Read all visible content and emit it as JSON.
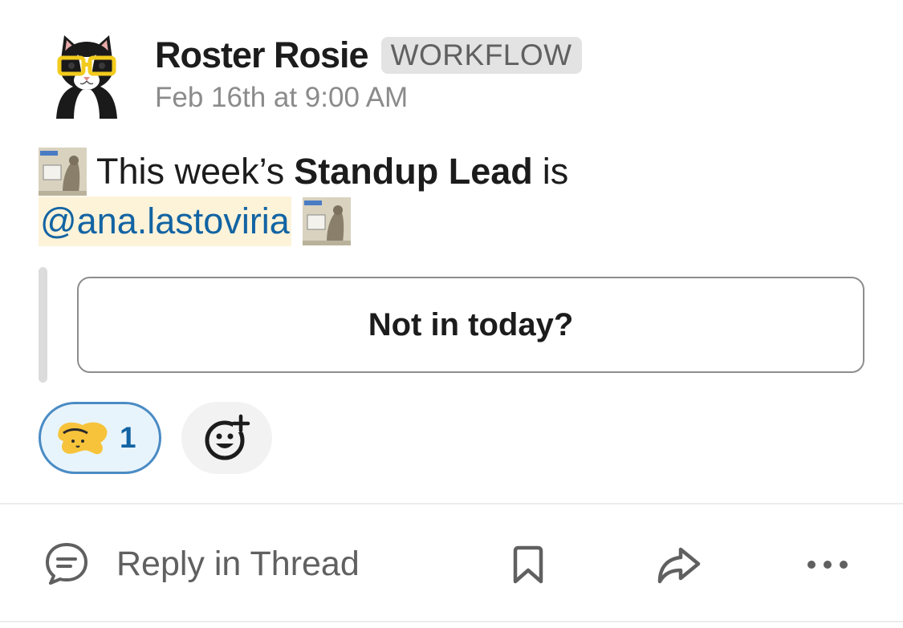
{
  "message": {
    "sender_name": "Roster Rosie",
    "app_badge": "WORKFLOW",
    "timestamp": "Feb 16th at 9:00 AM",
    "body": {
      "text_before": "This week’s",
      "bold": "Standup Lead",
      "text_after": "is",
      "mention": "@ana.lastoviria",
      "emoji_icon": "cat-meme-emoji"
    },
    "attachment": {
      "button_label": "Not in today?"
    },
    "reactions": [
      {
        "icon": "cat-paw-emoji",
        "count": "1",
        "selected": true
      }
    ],
    "add_reaction_icon": "add-reaction-icon"
  },
  "actions": {
    "reply_label": "Reply in Thread",
    "icons": [
      "reply-thread-icon",
      "bookmark-icon",
      "share-icon",
      "more-icon"
    ]
  },
  "colors": {
    "mention_text": "#1264a3",
    "mention_bg": "#fdf3d9",
    "reaction_border": "#4a8bc4",
    "reaction_bg": "#e8f4fb",
    "badge_bg": "#e3e3e3"
  }
}
